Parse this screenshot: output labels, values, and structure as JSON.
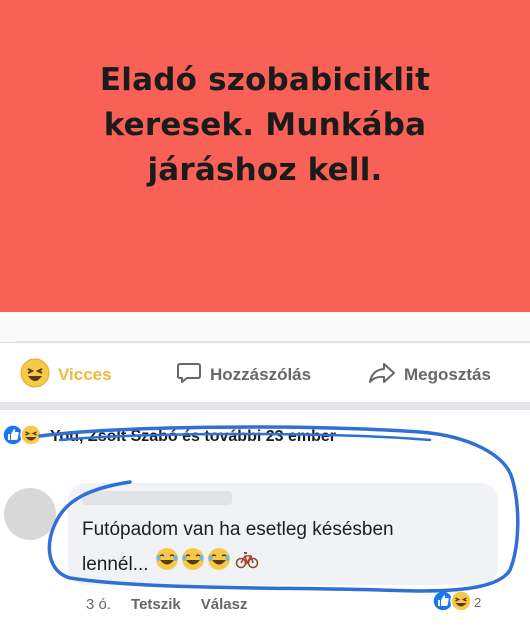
{
  "post": {
    "text": "Eladó szobabiciklit keresek. Munkába járáshoz kell.",
    "background_color": "#f96157"
  },
  "actions": {
    "reaction_label": "Vicces",
    "comment_label": "Hozzászólás",
    "share_label": "Megosztás"
  },
  "reactions": {
    "summary": "You, Zsolt Szabó és további 23 ember",
    "icons": [
      "like-icon",
      "haha-icon"
    ]
  },
  "comment": {
    "text_line1": "Futópadom van ha esetleg késésben",
    "text_line2": "lennél...",
    "emojis": [
      "laughing-emoji",
      "laughing-emoji",
      "laughing-emoji",
      "bicycle-emoji"
    ],
    "time": "3 ó.",
    "like_label": "Tetszik",
    "reply_label": "Válasz",
    "reaction_count": "2"
  },
  "colors": {
    "accent_blue": "#1877f2",
    "haha_yellow": "#f7c948",
    "annotation_blue": "#2f6fd6"
  }
}
